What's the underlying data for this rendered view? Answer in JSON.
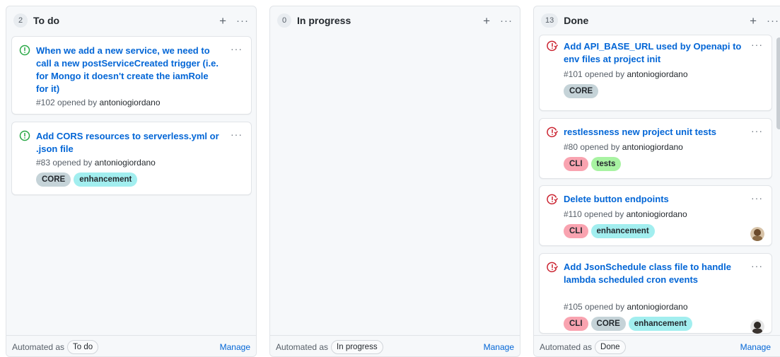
{
  "colors": {
    "open": "#28a745",
    "closed": "#cb2431",
    "link": "#0366d6"
  },
  "columns": [
    {
      "count": "2",
      "title": "To do",
      "add_icon": "plus-icon",
      "more_icon": "kebab-horizontal-icon",
      "cards": [
        {
          "status_icon": "issue-opened-icon",
          "title": "When we add a new service, we need to call a new postServiceCreated trigger (i.e. for Mongo it doesn't create the iamRole for it)",
          "number": "#102",
          "opened_by_text": "opened by",
          "author": "antoniogiordano",
          "labels": []
        },
        {
          "status_icon": "issue-opened-icon",
          "title": "Add CORS resources to serverless.yml or .json file",
          "number": "#83",
          "opened_by_text": "opened by",
          "author": "antoniogiordano",
          "labels": [
            "CORE",
            "enhancement"
          ]
        }
      ],
      "footer": {
        "automated_as": "Automated as",
        "preset": "To do",
        "manage": "Manage"
      }
    },
    {
      "count": "0",
      "title": "In progress",
      "cards": [],
      "footer": {
        "automated_as": "Automated as",
        "preset": "In progress",
        "manage": "Manage"
      }
    },
    {
      "count": "13",
      "title": "Done",
      "cards": [
        {
          "status_icon": "issue-closed-icon",
          "title": "Add API_BASE_URL used by Openapi to env files at project init",
          "number": "#101",
          "opened_by_text": "opened by",
          "author": "antoniogiordano",
          "labels": [
            "CORE"
          ]
        },
        {
          "status_icon": "issue-closed-icon",
          "title": "restlessness new project unit tests",
          "number": "#80",
          "opened_by_text": "opened by",
          "author": "antoniogiordano",
          "labels": [
            "CLI",
            "tests"
          ]
        },
        {
          "status_icon": "issue-closed-icon",
          "title": "Delete button endpoints",
          "number": "#110",
          "opened_by_text": "opened by",
          "author": "antoniogiordano",
          "labels": [
            "CLI",
            "enhancement"
          ],
          "assignee": "avatar"
        },
        {
          "status_icon": "issue-closed-icon",
          "title": "Add JsonSchedule class file to handle lambda scheduled cron events",
          "number": "#105",
          "opened_by_text": "opened by",
          "author": "antoniogiordano",
          "labels": [
            "CLI",
            "CORE",
            "enhancement"
          ],
          "assignee": "avatar"
        }
      ],
      "footer": {
        "automated_as": "Automated as",
        "preset": "Done",
        "manage": "Manage"
      }
    }
  ]
}
